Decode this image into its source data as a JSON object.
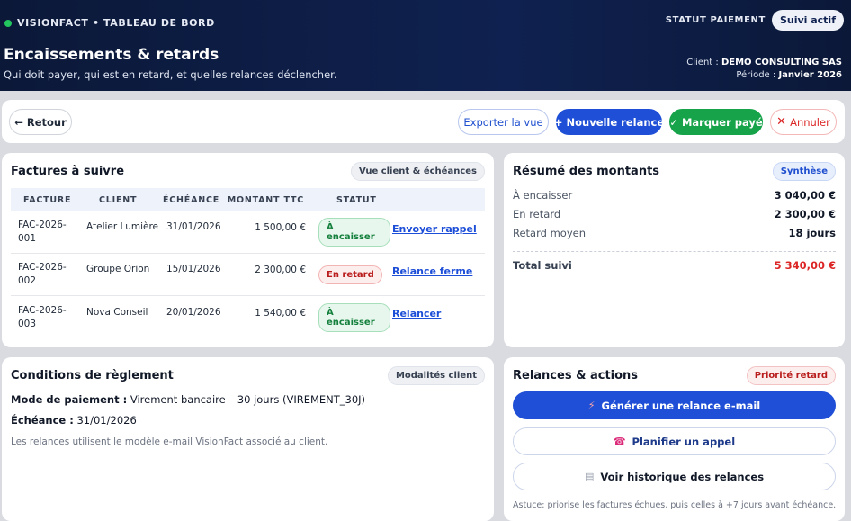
{
  "header": {
    "brand": "VISIONFACT • TABLEAU DE BORD",
    "status_label": "STATUT PAIEMENT",
    "status_value": "Suivi actif",
    "title": "Encaissements & retards",
    "subtitle": "Qui doit payer, qui est en retard, et quelles relances déclencher.",
    "client_label": "Client :",
    "client_value": "DEMO CONSULTING SAS",
    "period_label": "Période :",
    "period_value": "Janvier 2026"
  },
  "toolbar": {
    "back": "← Retour",
    "export": "Exporter la vue",
    "new_reminder": "+ Nouvelle relance",
    "mark_paid": "Marquer payé",
    "cancel": "Annuler"
  },
  "invoices": {
    "title": "Factures à suivre",
    "tag": "Vue client & échéances",
    "columns": [
      "FACTURE",
      "CLIENT",
      "ÉCHÉANCE",
      "MONTANT TTC",
      "STATUT"
    ],
    "rows": [
      {
        "invoice": "FAC-2026-001",
        "client": "Atelier Lumière",
        "due": "31/01/2026",
        "amount": "1 500,00 €",
        "status": "À encaisser",
        "action": "Envoyer rappel"
      },
      {
        "invoice": "FAC-2026-002",
        "client": "Groupe Orion",
        "due": "15/01/2026",
        "amount": "2 300,00 €",
        "status": "En retard",
        "action": "Relance ferme"
      },
      {
        "invoice": "FAC-2026-003",
        "client": "Nova Conseil",
        "due": "20/01/2026",
        "amount": "1 540,00 €",
        "status": "À encaisser",
        "action": "Relancer"
      }
    ]
  },
  "summary": {
    "title": "Résumé des montants",
    "tag": "Synthèse",
    "to_collect_label": "À encaisser",
    "to_collect_value": "3 040,00 €",
    "late_label": "En retard",
    "late_value": "2 300,00 €",
    "avg_delay_label": "Retard moyen",
    "avg_delay_value": "18 jours",
    "total_label": "Total suivi",
    "total_value": "5 340,00 €"
  },
  "conditions": {
    "title": "Conditions de règlement",
    "tag": "Modalités client",
    "payment_label": "Mode de paiement :",
    "payment_value": "Virement bancaire – 30 jours (VIREMENT_30J)",
    "due_label": "Échéance :",
    "due_value": "31/01/2026",
    "note": "Les relances utilisent le modèle e-mail VisionFact associé au client."
  },
  "actions": {
    "title": "Relances & actions",
    "tag": "Priorité retard",
    "generate": "Générer une relance e-mail",
    "call": "Planifier un appel",
    "history": "Voir historique des relances",
    "tip": "Astuce: priorise les factures échues, puis celles à +7 jours avant échéance."
  }
}
